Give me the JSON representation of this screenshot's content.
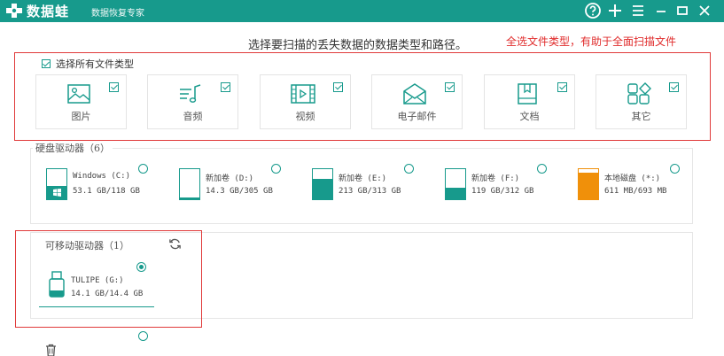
{
  "app": {
    "name": "数据蛙",
    "subtitle": "数据恢复专家"
  },
  "titlebar_buttons": {
    "help": "help-icon",
    "add": "plus-icon",
    "menu": "menu-icon",
    "minimize": "minimize-icon",
    "maximize": "maximize-icon",
    "close": "close-icon"
  },
  "main": {
    "hint": "选择要扫描的丢失数据的数据类型和路径。",
    "annotation": "全选文件类型，有助于全面扫描文件",
    "select_all_label": "选择所有文件类型",
    "select_all_checked": true
  },
  "file_types": [
    {
      "label": "图片",
      "icon": "image-icon",
      "checked": true
    },
    {
      "label": "音频",
      "icon": "audio-icon",
      "checked": true
    },
    {
      "label": "视频",
      "icon": "video-icon",
      "checked": true
    },
    {
      "label": "电子邮件",
      "icon": "email-icon",
      "checked": true
    },
    {
      "label": "文档",
      "icon": "document-icon",
      "checked": true
    },
    {
      "label": "其它",
      "icon": "other-icon",
      "checked": true
    }
  ],
  "hard_drives": {
    "title": "硬盘驱动器（6）",
    "items": [
      {
        "name": "Windows (C:)",
        "size": "53.1 GB/118 GB",
        "used_fraction": 0.45,
        "color": "#179a8c",
        "os": true
      },
      {
        "name": "新加卷 (D:)",
        "size": "14.3 GB/305 GB",
        "used_fraction": 0.05,
        "color": "#179a8c"
      },
      {
        "name": "新加卷 (E:)",
        "size": "213 GB/313 GB",
        "used_fraction": 0.68,
        "color": "#179a8c"
      },
      {
        "name": "新加卷 (F:)",
        "size": "119 GB/312 GB",
        "used_fraction": 0.38,
        "color": "#179a8c"
      },
      {
        "name": "本地磁盘 (*:)",
        "size": "611 MB/693 MB",
        "used_fraction": 0.88,
        "color": "#f0900a"
      }
    ]
  },
  "removable_drives": {
    "title": "可移动驱动器（1）",
    "refresh_icon": "refresh-icon",
    "items": [
      {
        "name": "TULIPE (G:)",
        "size": "14.1 GB/14.4 GB",
        "selected": true
      }
    ]
  },
  "footer": {
    "trash_icon": "trash-icon"
  },
  "colors": {
    "accent": "#179a8c",
    "highlight": "#e03a3a",
    "warn": "#f0900a"
  }
}
